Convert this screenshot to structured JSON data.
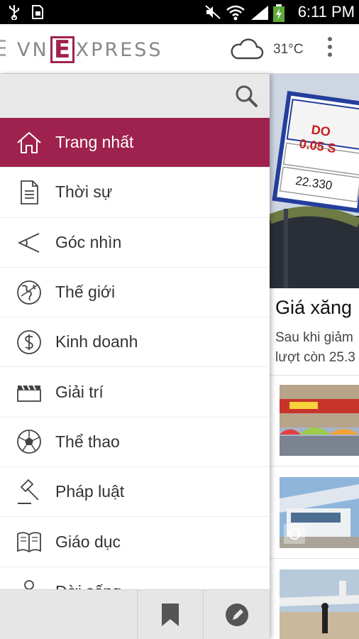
{
  "status_bar": {
    "time": "6:11 PM",
    "icons": [
      "usb-icon",
      "sim-icon",
      "mute-icon",
      "wifi-icon",
      "signal-icon",
      "battery-charging-icon"
    ]
  },
  "header": {
    "logo_left": "VN",
    "logo_mid": "E",
    "logo_right": "XPRESS",
    "temperature": "31°C"
  },
  "drawer": {
    "items": [
      {
        "label": "Trang nhất",
        "icon": "home-icon",
        "active": true
      },
      {
        "label": "Thời sự",
        "icon": "document-icon"
      },
      {
        "label": "Góc nhìn",
        "icon": "perspective-icon"
      },
      {
        "label": "Thế giới",
        "icon": "globe-icon"
      },
      {
        "label": "Kinh doanh",
        "icon": "dollar-icon"
      },
      {
        "label": "Giải trí",
        "icon": "clapperboard-icon"
      },
      {
        "label": "Thể thao",
        "icon": "soccer-ball-icon"
      },
      {
        "label": "Pháp luật",
        "icon": "gavel-icon"
      },
      {
        "label": "Giáo dục",
        "icon": "open-book-icon"
      },
      {
        "label": "Đời sống",
        "icon": "person-icon"
      }
    ]
  },
  "article": {
    "headline": "Giá xăng",
    "summary_line1": "Sau khi giảm",
    "summary_line2": "lượt còn 25.3",
    "sign_line1": "DO",
    "sign_line2": "0.05 S",
    "sign_price": "22.330"
  },
  "colors": {
    "brand": "#9f224e",
    "drawer_bottom": "#e6e6e6",
    "search_bg": "#e8e8e8"
  }
}
